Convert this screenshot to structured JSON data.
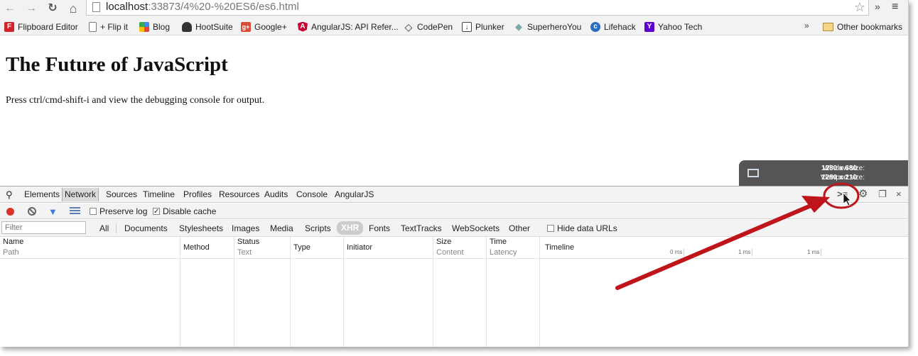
{
  "browser": {
    "url_host": "localhost",
    "url_rest": ":33873/4%20-%20ES6/es6.html",
    "nav": {
      "back": "←",
      "forward": "→",
      "reload": "↻",
      "home": "⌂"
    },
    "star_icon": "☆",
    "extensions_more": "»",
    "menu_icon": "≡"
  },
  "bookmarks": {
    "items": [
      {
        "label": "Flipboard Editor",
        "icon": "F",
        "color": "#d0232b"
      },
      {
        "label": "+ Flip it",
        "icon": "",
        "color": "#ffffff"
      },
      {
        "label": "Blog",
        "icon": "",
        "color": "#3b7ddd"
      },
      {
        "label": "HootSuite",
        "icon": "",
        "color": "#333333"
      },
      {
        "label": "Google+",
        "icon": "g+",
        "color": "#dd4b39"
      },
      {
        "label": "AngularJS: API Refer...",
        "icon": "A",
        "color": "#c3002f"
      },
      {
        "label": "CodePen",
        "icon": "◇",
        "color": "#555555"
      },
      {
        "label": "Plunker",
        "icon": "↓",
        "color": "#444444"
      },
      {
        "label": "SuperheroYou",
        "icon": "◆",
        "color": "#7fa8a8"
      },
      {
        "label": "Lifehack",
        "icon": "c",
        "color": "#2b6fc4"
      },
      {
        "label": "Yahoo Tech",
        "icon": "Y",
        "color": "#5f01d1"
      }
    ],
    "more": "»",
    "other": "Other bookmarks"
  },
  "page": {
    "heading": "The Future of JavaScript",
    "text": "Press ctrl/cmd-shift-i and view the debugging console for output."
  },
  "size_overlay": {
    "window_label": "Window size:",
    "window_value": "1280 x 680",
    "viewport_label": "Viewport size:",
    "viewport_value": "1280 x 210"
  },
  "devtools": {
    "tabs": [
      "Elements",
      "Network",
      "Sources",
      "Timeline",
      "Profiles",
      "Resources",
      "Audits",
      "Console",
      "AngularJS"
    ],
    "selected_tab": "Network",
    "network_toolbar": {
      "preserve_log": "Preserve log",
      "disable_cache": "Disable cache",
      "disable_cache_checked": true,
      "preserve_log_checked": false
    },
    "filter_placeholder": "Filter",
    "filter_types": [
      "All",
      "Documents",
      "Stylesheets",
      "Images",
      "Media",
      "Scripts",
      "XHR",
      "Fonts",
      "TextTracks",
      "WebSockets",
      "Other"
    ],
    "selected_filter": "XHR",
    "hide_data_urls": "Hide data URLs",
    "columns": [
      {
        "top": "Name",
        "bottom": "Path"
      },
      {
        "top": "Method",
        "bottom": ""
      },
      {
        "top": "Status",
        "bottom": "Text"
      },
      {
        "top": "Type",
        "bottom": ""
      },
      {
        "top": "Initiator",
        "bottom": ""
      },
      {
        "top": "Size",
        "bottom": "Content"
      },
      {
        "top": "Time",
        "bottom": "Latency"
      },
      {
        "top": "Timeline",
        "bottom": ""
      }
    ],
    "timeline_ticks": [
      "0 ms",
      "1 ms",
      "1 ms"
    ]
  },
  "colors": {
    "record": "#d9322b",
    "annotation": "#c0141b",
    "overlay_bg": "#555555"
  }
}
